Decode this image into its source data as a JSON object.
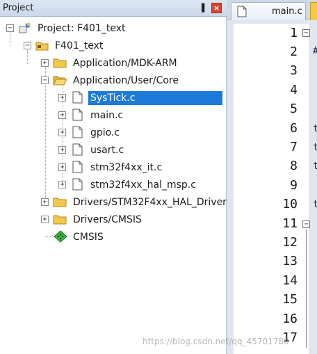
{
  "panel": {
    "title": "Project",
    "pin_glyph": "▐",
    "close_glyph": "×"
  },
  "tree": {
    "root": "Project: F401_text",
    "target": "F401_text",
    "groups": [
      {
        "label": "Application/MDK-ARM",
        "expanded": false
      },
      {
        "label": "Application/User/Core",
        "expanded": true
      },
      {
        "label": "Drivers/STM32F4xx_HAL_Driver",
        "expanded": false
      },
      {
        "label": "Drivers/CMSIS",
        "expanded": false
      }
    ],
    "core_files": [
      {
        "label": "SysTick.c",
        "selected": true
      },
      {
        "label": "main.c",
        "selected": false
      },
      {
        "label": "gpio.c",
        "selected": false
      },
      {
        "label": "usart.c",
        "selected": false
      },
      {
        "label": "stm32f4xx_it.c",
        "selected": false
      },
      {
        "label": "stm32f4xx_hal_msp.c",
        "selected": false
      }
    ],
    "cmsis": "CMSIS"
  },
  "editor": {
    "tab_label": "main.c",
    "line_numbers": [
      "1",
      "2",
      "3",
      "4",
      "5",
      "6",
      "7",
      "8",
      "9",
      "10",
      "11",
      "12",
      "13",
      "14",
      "15",
      "16",
      "17"
    ],
    "code_fragments": [
      "└",
      "#",
      "t",
      "t",
      "t",
      "t"
    ]
  },
  "watermark": "https://blog.csdn.net/qq_45701780",
  "colors": {
    "selection": "#1c7bd9",
    "header": "#c9d8ea",
    "close": "#d9452f"
  }
}
